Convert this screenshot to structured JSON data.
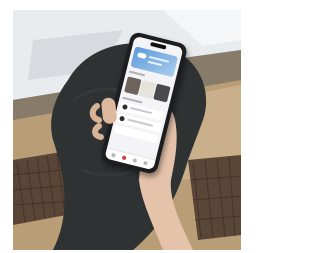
{
  "photo": {
    "subject": "phone-in-hand"
  },
  "colors": {
    "wall_light": "#e9ecef",
    "wall_shadow": "#6f6f6a",
    "floor": "#b89d76",
    "trousers": "#2f3232",
    "phone_body": "#1c1d20",
    "screen_bg": "#f4f4f6",
    "weather_accent": "#5c9ad8",
    "skin": "#e4c3aa"
  }
}
